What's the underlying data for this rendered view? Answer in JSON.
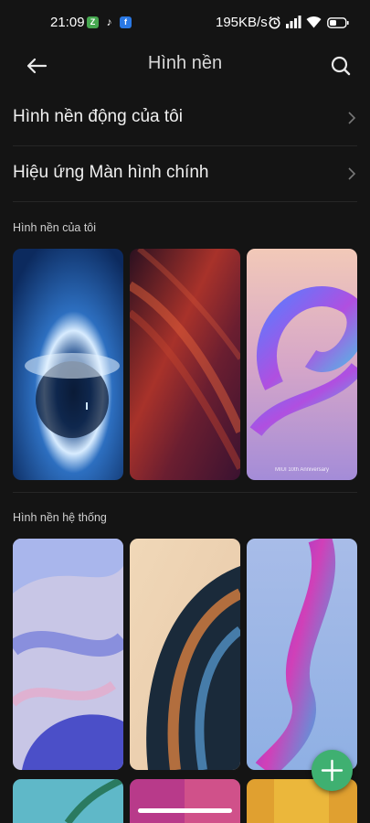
{
  "status_bar": {
    "time": "21:09",
    "app_icons": [
      "zalo-icon",
      "tiktok-icon",
      "facebook-icon"
    ],
    "app_icon_letters": {
      "zalo": "Z",
      "tiktok": "♪",
      "facebook": "f"
    },
    "net_speed": "195KB/s",
    "indicators": [
      "alarm-icon",
      "signal-icon",
      "wifi-icon",
      "battery-icon"
    ]
  },
  "header": {
    "title": "Hình nền"
  },
  "menu": [
    {
      "label": "Hình nền động của tôi"
    },
    {
      "label": "Hiệu ứng Màn hình chính"
    }
  ],
  "sections": {
    "mine": {
      "title": "Hình nền của tôi",
      "wallpapers": [
        {
          "name": "ice-cave"
        },
        {
          "name": "red-curves"
        },
        {
          "name": "miui-10th",
          "caption": "MIUI 10th Anniversary"
        }
      ]
    },
    "system": {
      "title": "Hình nền hệ thống",
      "wallpapers": [
        {
          "name": "lavender-abstract"
        },
        {
          "name": "glass-curves"
        },
        {
          "name": "blue-purple-wave"
        }
      ]
    }
  },
  "colors": {
    "background": "#141414",
    "accent_fab": "#3fb071",
    "divider": "#262626"
  }
}
